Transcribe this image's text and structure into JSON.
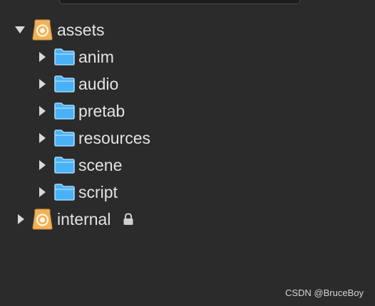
{
  "tree": {
    "root": {
      "label": "assets",
      "expanded": true,
      "icon": "database-icon",
      "children": [
        {
          "label": "anim",
          "icon": "folder-icon",
          "expanded": false
        },
        {
          "label": "audio",
          "icon": "folder-icon",
          "expanded": false
        },
        {
          "label": "pretab",
          "icon": "folder-icon",
          "expanded": false
        },
        {
          "label": "resources",
          "icon": "folder-icon",
          "expanded": false
        },
        {
          "label": "scene",
          "icon": "folder-icon",
          "expanded": false
        },
        {
          "label": "script",
          "icon": "folder-icon",
          "expanded": false
        }
      ]
    },
    "internal": {
      "label": "internal",
      "expanded": false,
      "icon": "database-icon",
      "locked": true,
      "lock_icon": "lock-icon"
    }
  },
  "watermark": "CSDN @BruceBoy",
  "colors": {
    "background": "#2b2b2b",
    "text": "#e3e3e3",
    "folder": "#49b2f7",
    "database": "#f2b25a",
    "arrow": "#d9d9d9",
    "lock": "#cfcfcf"
  }
}
